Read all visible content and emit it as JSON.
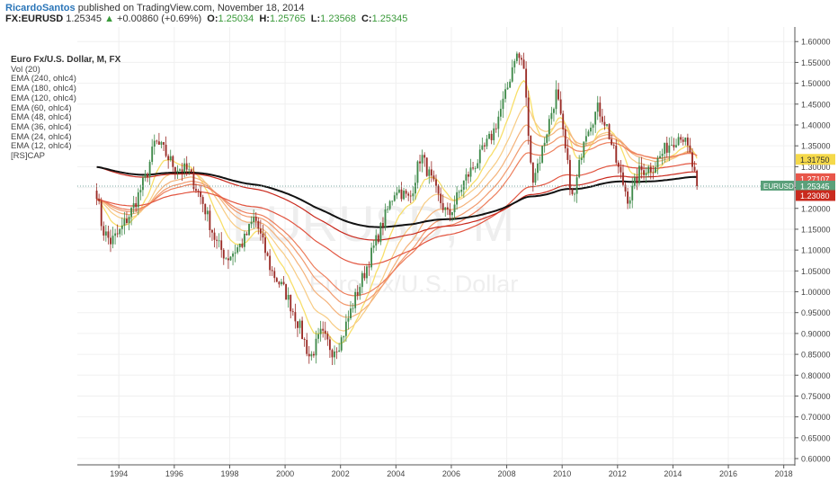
{
  "header": {
    "author": "RicardoSantos",
    "published": "published on TradingView.com, November 18, 2014",
    "symbol": "FX:EURUSD",
    "last": "1.25345",
    "change": "+0.00860 (+0.69%)",
    "o_label": "O:",
    "o": "1.25034",
    "h_label": "H:",
    "h": "1.25765",
    "l_label": "L:",
    "l": "1.23568",
    "c_label": "C:",
    "c": "1.25345"
  },
  "legend": {
    "title": "Euro Fx/U.S. Dollar, M, FX",
    "items": [
      "Vol (20)",
      "EMA (240, ohlc4)",
      "EMA (180, ohlc4)",
      "EMA (120, ohlc4)",
      "EMA (60, ohlc4)",
      "EMA (48, ohlc4)",
      "EMA (36, ohlc4)",
      "EMA (24, ohlc4)",
      "EMA (12, ohlc4)",
      "[RS]CAP"
    ]
  },
  "watermark": {
    "symbol": "EURUSD, M",
    "name": "Euro Fx/U.S. Dollar"
  },
  "price_labels": [
    {
      "text": "1.31750",
      "value": 1.3175,
      "color": "#f5d94a",
      "text_color": "#333333"
    },
    {
      "text": "1.27107",
      "value": 1.27107,
      "color": "#e8564a",
      "text_color": "#ffffff"
    },
    {
      "text": "EURUSD",
      "value": 1.25345,
      "color": "#5aa07a",
      "text_color": "#ffffff",
      "is_symbol": true
    },
    {
      "text": "1.25345",
      "value": 1.25345,
      "color": "#5aa07a",
      "text_color": "#ffffff"
    },
    {
      "text": "1.23080",
      "value": 1.2308,
      "color": "#c92a1e",
      "text_color": "#ffffff"
    }
  ],
  "chart_data": {
    "type": "candlestick",
    "title": "Euro Fx/U.S. Dollar, M, FX",
    "x_ticks": [
      "1994",
      "1996",
      "1998",
      "2000",
      "2002",
      "2004",
      "2006",
      "2008",
      "2010",
      "2012",
      "2014",
      "2016",
      "2018"
    ],
    "y_ticks": [
      "0.60000",
      "0.65000",
      "0.70000",
      "0.75000",
      "0.80000",
      "0.85000",
      "0.90000",
      "0.95000",
      "1.00000",
      "1.05000",
      "1.10000",
      "1.15000",
      "1.20000",
      "1.25000",
      "1.30000",
      "1.35000",
      "1.40000",
      "1.45000",
      "1.50000",
      "1.55000",
      "1.60000"
    ],
    "ylim": [
      0.585,
      1.635
    ],
    "xlim": [
      1992.5,
      2018.4
    ],
    "price_keypoints": [
      [
        1993.2,
        1.24
      ],
      [
        1993.4,
        1.15
      ],
      [
        1993.7,
        1.12
      ],
      [
        1994.0,
        1.14
      ],
      [
        1994.5,
        1.2
      ],
      [
        1995.0,
        1.28
      ],
      [
        1995.3,
        1.36
      ],
      [
        1995.6,
        1.34
      ],
      [
        1996.0,
        1.3
      ],
      [
        1996.5,
        1.29
      ],
      [
        1997.0,
        1.22
      ],
      [
        1997.5,
        1.12
      ],
      [
        1997.9,
        1.08
      ],
      [
        1998.5,
        1.12
      ],
      [
        1998.9,
        1.18
      ],
      [
        1999.5,
        1.05
      ],
      [
        2000.0,
        1.0
      ],
      [
        2000.5,
        0.92
      ],
      [
        2000.9,
        0.84
      ],
      [
        2001.3,
        0.9
      ],
      [
        2001.7,
        0.86
      ],
      [
        2002.0,
        0.88
      ],
      [
        2002.5,
        0.98
      ],
      [
        2003.0,
        1.07
      ],
      [
        2003.5,
        1.16
      ],
      [
        2004.0,
        1.25
      ],
      [
        2004.5,
        1.22
      ],
      [
        2004.9,
        1.33
      ],
      [
        2005.5,
        1.23
      ],
      [
        2005.9,
        1.18
      ],
      [
        2006.5,
        1.27
      ],
      [
        2007.0,
        1.32
      ],
      [
        2007.5,
        1.38
      ],
      [
        2008.0,
        1.48
      ],
      [
        2008.3,
        1.57
      ],
      [
        2008.6,
        1.55
      ],
      [
        2008.9,
        1.27
      ],
      [
        2009.2,
        1.32
      ],
      [
        2009.8,
        1.48
      ],
      [
        2010.4,
        1.21
      ],
      [
        2010.8,
        1.38
      ],
      [
        2011.3,
        1.44
      ],
      [
        2011.6,
        1.4
      ],
      [
        2012.0,
        1.3
      ],
      [
        2012.4,
        1.22
      ],
      [
        2012.8,
        1.29
      ],
      [
        2013.3,
        1.3
      ],
      [
        2013.8,
        1.35
      ],
      [
        2014.3,
        1.38
      ],
      [
        2014.6,
        1.33
      ],
      [
        2014.87,
        1.2535
      ]
    ],
    "ema_series": [
      {
        "period": 240,
        "color": "#111111",
        "width": 2.0
      },
      {
        "period": 180,
        "color": "#c9281c",
        "width": 1.2
      },
      {
        "period": 120,
        "color": "#e25540",
        "width": 1.2
      },
      {
        "period": 60,
        "color": "#ed7e5c",
        "width": 1.2
      },
      {
        "period": 48,
        "color": "#f19a6e",
        "width": 1.2
      },
      {
        "period": 36,
        "color": "#f4b27a",
        "width": 1.2
      },
      {
        "period": 24,
        "color": "#f7cb83",
        "width": 1.2
      },
      {
        "period": 12,
        "color": "#f8df6a",
        "width": 1.3
      }
    ],
    "candle_colors": {
      "up": "#3f8a4a",
      "down": "#9a2b26"
    },
    "last_price": 1.25345
  }
}
